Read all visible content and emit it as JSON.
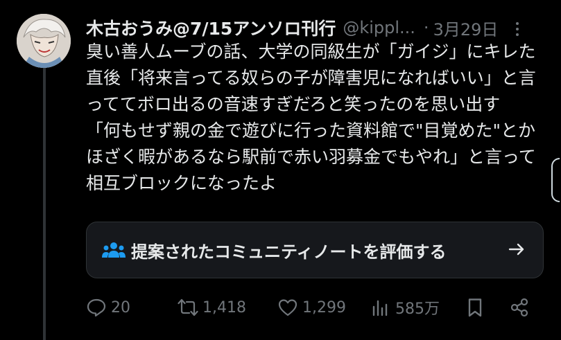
{
  "post": {
    "display_name": "木古おうみ@7/15アンソロ刊行",
    "handle": "@kippl...",
    "separator": "·",
    "timestamp": "3月29日",
    "avatar_icon": "profile-avatar",
    "body_paragraphs": [
      "臭い善人ムーブの話、大学の同級生が「ガイジ」にキレた直後「将来言ってる奴らの子が障害児になればいい」と言っててボロ出るの音速すぎだろと笑ったのを思い出す",
      "「何もせず親の金で遊びに行った資料館で\"目覚めた\"とかほざく暇があるなら駅前で赤い羽募金でもやれ」と言って相互ブロックになったよ"
    ]
  },
  "community_note": {
    "label": "提案されたコミュニティノートを評価する",
    "icon": "people-icon",
    "arrow_icon": "arrow-right-icon"
  },
  "actions": {
    "reply_count": "20",
    "repost_count": "1,418",
    "like_count": "1,299",
    "views_count": "585万"
  },
  "colors": {
    "background": "#000000",
    "text_primary": "#e7e9ea",
    "text_secondary": "#71767b",
    "accent": "#1d9bf0",
    "card_bg": "#16181c",
    "border": "#2f3336"
  }
}
